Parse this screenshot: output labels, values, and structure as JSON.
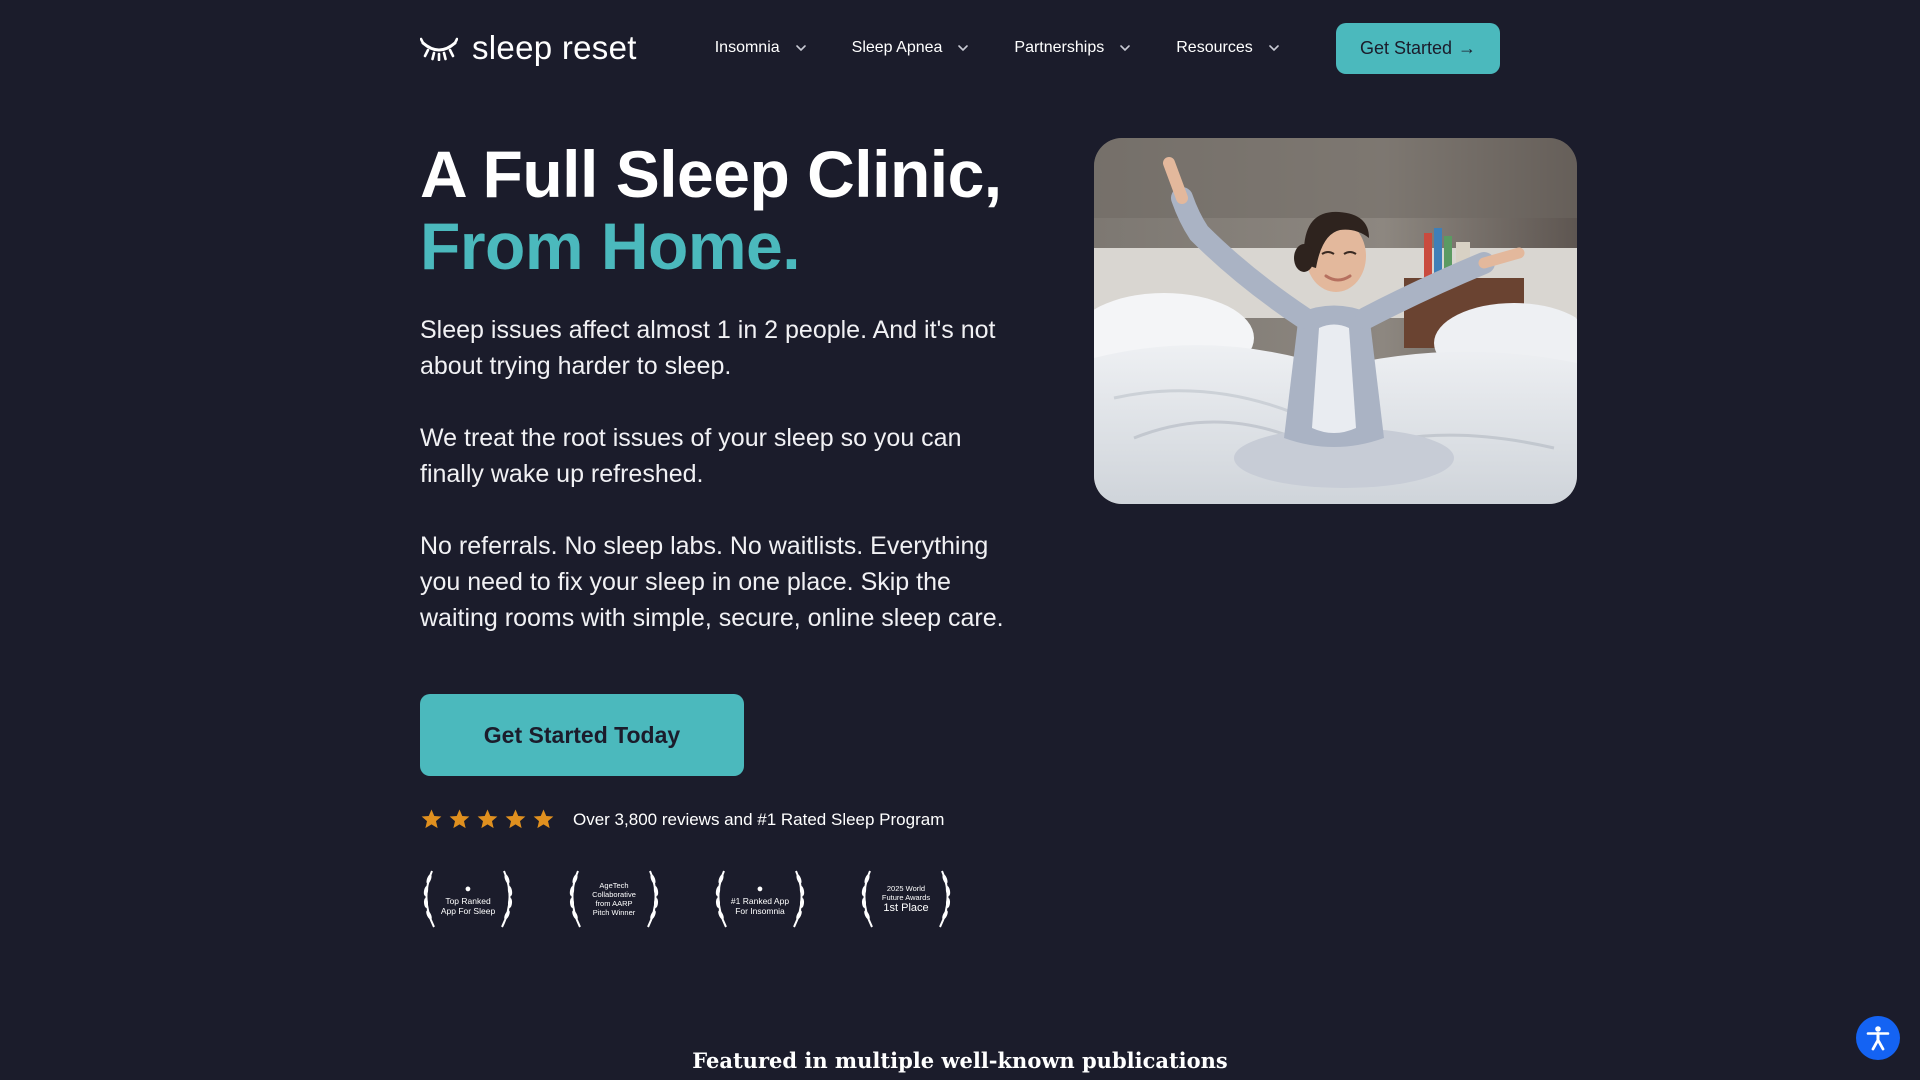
{
  "header": {
    "logo_text": "sleep reset",
    "nav": [
      {
        "label": "Insomnia"
      },
      {
        "label": "Sleep Apnea"
      },
      {
        "label": "Partnerships"
      },
      {
        "label": "Resources"
      }
    ],
    "cta_label": "Get Started",
    "cta_arrow": "→"
  },
  "hero": {
    "headline_line1": "A Full Sleep Clinic,",
    "headline_line2": "From Home.",
    "para1": "Sleep issues affect almost 1 in 2 people. And it's not about trying harder to sleep.",
    "para2": "We treat the root issues of your sleep so you can finally wake up refreshed.",
    "para3": "No referrals. No sleep labs. No waitlists. Everything you need to fix your sleep in one place. Skip the waiting rooms with simple, secure, online sleep care.",
    "cta_label": "Get Started Today",
    "rating": {
      "stars": 5,
      "text": "Over 3,800 reviews and #1 Rated Sleep Program"
    },
    "awards": [
      {
        "line1": "Top Ranked",
        "line2": "App For Sleep"
      },
      {
        "line1": "AgeTech",
        "line2": "Collaborative",
        "line3": "from AARP",
        "line4": "Pitch Winner"
      },
      {
        "line1": "#1 Ranked App",
        "line2": "For Insomnia"
      },
      {
        "line1": "2025 World",
        "line2": "Future Awards",
        "line3": "1st Place"
      }
    ]
  },
  "featured": {
    "text": "Featured in multiple well-known publications"
  },
  "colors": {
    "background": "#1b1c2b",
    "accent": "#4bb9bd",
    "star": "#e0901f",
    "a11y": "#1463f3"
  },
  "icons": [
    "eye-lash-logo-icon",
    "chevron-down-icon",
    "star-icon",
    "apple-icon",
    "laurel-icon",
    "accessibility-icon"
  ]
}
